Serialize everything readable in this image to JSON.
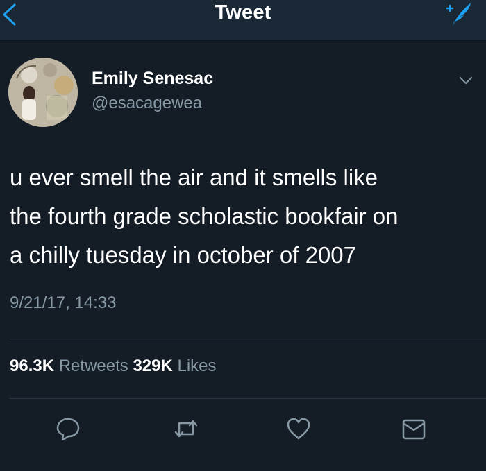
{
  "header": {
    "title": "Tweet",
    "back_icon": "chevron-left-icon",
    "compose_icon": "compose-tweet-icon"
  },
  "tweet": {
    "author_name": "Emily Senesac",
    "author_handle": "@esacagewea",
    "text_lines": [
      "u ever smell the air and it smells like",
      "the fourth grade scholastic bookfair on",
      "a chilly tuesday in october of 2007"
    ],
    "timestamp": "9/21/17, 14:33",
    "retweets_count": "96.3K",
    "retweets_label": "Retweets",
    "likes_count": "329K",
    "likes_label": "Likes"
  },
  "actions": [
    "reply-icon",
    "retweet-icon",
    "like-icon",
    "direct-message-icon"
  ],
  "colors": {
    "background": "#141d26",
    "topbar": "#1b2836",
    "accent": "#1da1f2",
    "secondary_text": "#8899a6",
    "divider": "#2a3744"
  }
}
